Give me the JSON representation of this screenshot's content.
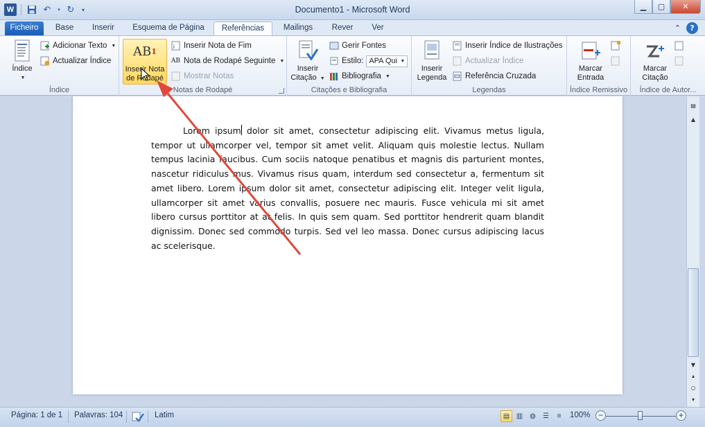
{
  "titlebar": {
    "title": "Documento1  -  Microsoft Word",
    "app_icon": "word-logo",
    "qat": [
      "save-icon",
      "undo-icon",
      "redo-icon",
      "customize-qat-icon"
    ],
    "window_buttons": [
      "minimize-icon",
      "maximize-icon",
      "close-icon"
    ]
  },
  "tabs": {
    "file": "Ficheiro",
    "items": [
      "Base",
      "Inserir",
      "Esquema de Página",
      "Referências",
      "Mailings",
      "Rever",
      "Ver"
    ],
    "active": "Referências"
  },
  "ribbon": {
    "indice": {
      "group_label": "Índice",
      "big_button": "Índice",
      "add_text": "Adicionar Texto",
      "update_index": "Actualizar Índice"
    },
    "notas": {
      "group_label": "Notas de Rodapé",
      "big_button_line1": "Inserir Nota",
      "big_button_line2": "de Rodapé",
      "big_icon_text": "AB",
      "big_icon_sup": "1",
      "insert_endnote": "Inserir Nota de Fim",
      "next_footnote": "Nota de Rodapé Seguinte",
      "show_notes": "Mostrar Notas"
    },
    "citacoes": {
      "group_label": "Citações e Bibliografia",
      "big_button_line1": "Inserir",
      "big_button_line2": "Citação",
      "manage_sources": "Gerir Fontes",
      "style_label": "Estilo:",
      "style_value": "APA Qui",
      "bibliography": "Bibliografia"
    },
    "legendas": {
      "group_label": "Legendas",
      "big_button_line1": "Inserir",
      "big_button_line2": "Legenda",
      "insert_table_figures": "Inserir Índice de Ilustrações",
      "update_table": "Actualizar Índice",
      "cross_reference": "Referência Cruzada"
    },
    "remissivo": {
      "group_label": "Índice Remissivo",
      "big_button_line1": "Marcar",
      "big_button_line2": "Entrada"
    },
    "autoridades": {
      "group_label": "Índice de Autor...",
      "big_button_line1": "Marcar",
      "big_button_line2": "Citação"
    }
  },
  "document": {
    "text_before_cursor": "Lorem ipsum",
    "text_after_cursor": " dolor sit amet, consectetur adipiscing elit. Vivamus metus ligula, tempor ut ullamcorper vel, tempor sit amet velit. Aliquam quis molestie lectus. Nullam tempus lacinia faucibus. Cum sociis natoque penatibus et magnis dis parturient montes, nascetur ridiculus mus. Vivamus risus quam, interdum sed consectetur a, fermentum sit amet libero. Lorem ipsum dolor sit amet, consectetur adipiscing elit. Integer velit ligula, ullamcorper sit amet varius convallis, posuere nec mauris. Fusce vehicula mi sit amet libero cursus porttitor at at felis. In quis sem quam. Sed porttitor hendrerit quam blandit dignissim. Donec sed commodo turpis. Sed vel leo massa. Donec cursus adipiscing lacus ac scelerisque."
  },
  "statusbar": {
    "page": "Página: 1 de 1",
    "words": "Palavras: 104",
    "language": "Latim",
    "zoom": "100%",
    "zoom_minus": "−",
    "zoom_plus": "+"
  },
  "colors": {
    "annotation_arrow": "#e0483a",
    "file_tab": "#1b5bb5",
    "highlight": "#ffd75e"
  }
}
